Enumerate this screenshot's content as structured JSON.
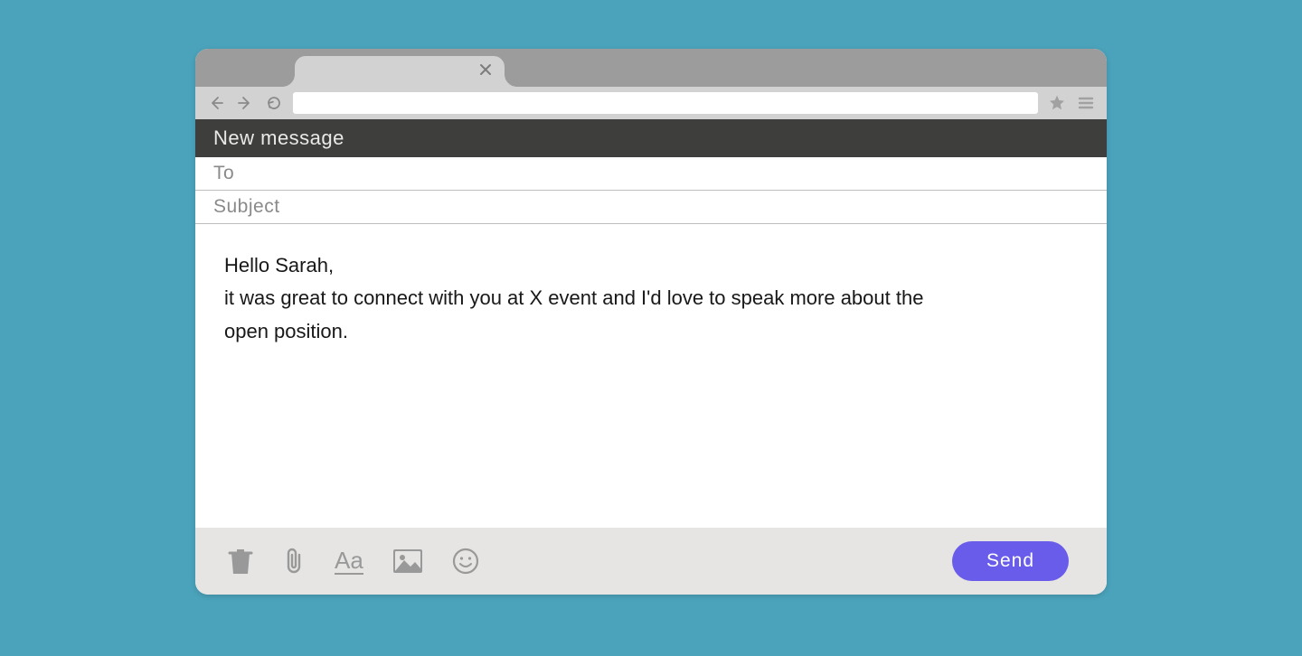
{
  "compose": {
    "title": "New message",
    "to_label": "To",
    "subject_label": "Subject",
    "body_line1": "Hello Sarah,",
    "body_line2": "it was great to connect with you at X event and I'd love to speak more about the open position.",
    "send_label": "Send"
  },
  "toolbar_icons": {
    "format_text": "Aa"
  }
}
